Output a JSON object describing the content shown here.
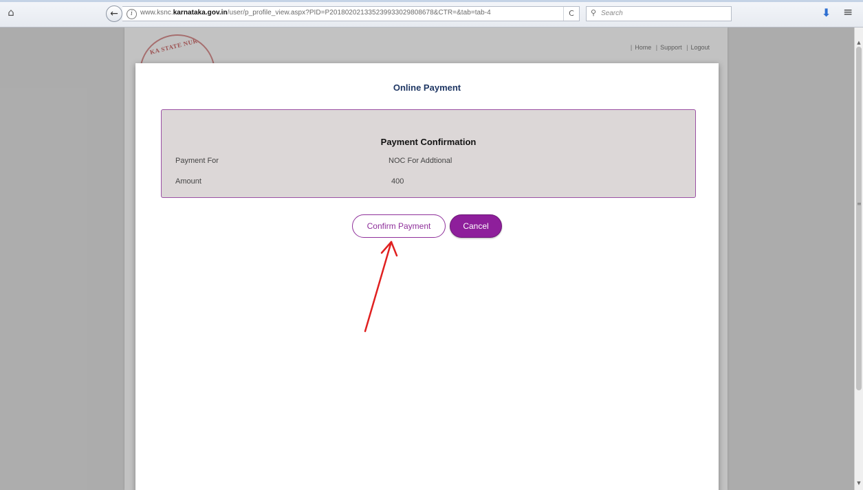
{
  "browser": {
    "url_prefix": "www.ksnc.",
    "url_domain": "karnataka.gov.in",
    "url_path": "/user/p_profile_view.aspx?PID=P201802021335239933029808678&CTR=&tab=tab-4",
    "search_placeholder": "Search",
    "home_icon": "⌂",
    "back_icon": "←",
    "info_icon": "i",
    "reload_icon": "C",
    "search_glyph": "⚲",
    "download_icon": "⬇",
    "menu_icon": "≡"
  },
  "site": {
    "logo_text": "KA STATE NURS",
    "nav": {
      "home": "Home",
      "support": "Support",
      "logout": "Logout"
    }
  },
  "modal": {
    "title": "Online Payment",
    "panel_heading": "Payment Confirmation",
    "rows": [
      {
        "label": "Payment For",
        "value": "NOC For Addtional"
      },
      {
        "label": "Amount",
        "value": "400"
      }
    ],
    "confirm_label": "Confirm Payment",
    "cancel_label": "Cancel"
  },
  "colors": {
    "accent": "#8e1f9b",
    "title": "#1f3764",
    "annotation_arrow": "#e02020"
  }
}
